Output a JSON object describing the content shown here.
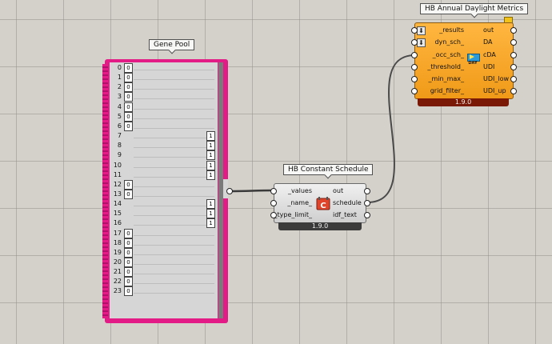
{
  "gene_pool": {
    "title": "Gene Pool",
    "genes": [
      {
        "index": "0",
        "value": "0",
        "side": "left"
      },
      {
        "index": "1",
        "value": "0",
        "side": "left"
      },
      {
        "index": "2",
        "value": "0",
        "side": "left"
      },
      {
        "index": "3",
        "value": "0",
        "side": "left"
      },
      {
        "index": "4",
        "value": "0",
        "side": "left"
      },
      {
        "index": "5",
        "value": "0",
        "side": "left"
      },
      {
        "index": "6",
        "value": "0",
        "side": "left"
      },
      {
        "index": "7",
        "value": "1",
        "side": "right"
      },
      {
        "index": "8",
        "value": "1",
        "side": "right"
      },
      {
        "index": "9",
        "value": "1",
        "side": "right"
      },
      {
        "index": "10",
        "value": "1",
        "side": "right"
      },
      {
        "index": "11",
        "value": "1",
        "side": "right"
      },
      {
        "index": "12",
        "value": "0",
        "side": "left"
      },
      {
        "index": "13",
        "value": "0",
        "side": "left"
      },
      {
        "index": "14",
        "value": "1",
        "side": "right"
      },
      {
        "index": "15",
        "value": "1",
        "side": "right"
      },
      {
        "index": "16",
        "value": "1",
        "side": "right"
      },
      {
        "index": "17",
        "value": "0",
        "side": "left"
      },
      {
        "index": "18",
        "value": "0",
        "side": "left"
      },
      {
        "index": "19",
        "value": "0",
        "side": "left"
      },
      {
        "index": "20",
        "value": "0",
        "side": "left"
      },
      {
        "index": "21",
        "value": "0",
        "side": "left"
      },
      {
        "index": "22",
        "value": "0",
        "side": "left"
      },
      {
        "index": "23",
        "value": "0",
        "side": "left"
      }
    ]
  },
  "constant_schedule": {
    "title": "HB Constant Schedule",
    "inputs": [
      "_values",
      "_name_",
      "_type_limit_"
    ],
    "outputs": [
      "out",
      "schedule",
      "idf_text"
    ],
    "icon": "calendar-c-icon",
    "version": "1.9.0"
  },
  "daylight_metrics": {
    "title": "HB Annual Daylight Metrics",
    "inputs": [
      "_results",
      "dyn_sch_",
      "_occ_sch_",
      "_threshold_",
      "_min_max_",
      "grid_filter_"
    ],
    "outputs": [
      "out",
      "DA",
      "cDA",
      "UDI",
      "UDI_low",
      "UDI_up"
    ],
    "icon_text": "DAY",
    "version": "1.9.0"
  },
  "colors": {
    "canvas": "#d4d1cb",
    "gene_pool": "#e21b86",
    "daylight_body": "#f5a01e",
    "footer": "#3b3b3b"
  }
}
